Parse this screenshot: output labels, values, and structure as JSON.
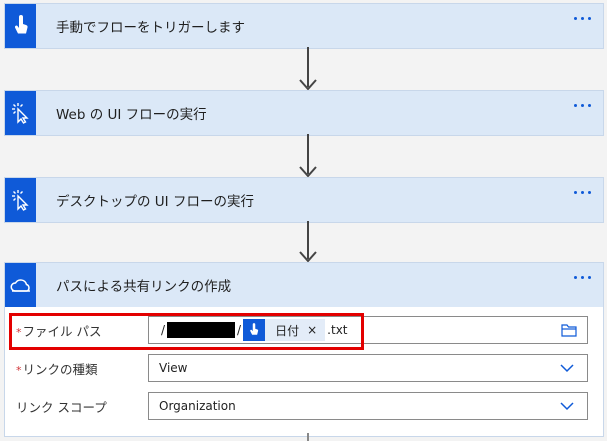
{
  "steps": [
    {
      "title": "手動でフローをトリガーします",
      "icon": "touch-icon"
    },
    {
      "title": "Web の UI フローの実行",
      "icon": "cursor-click-icon"
    },
    {
      "title": "デスクトップの UI フローの実行",
      "icon": "cursor-click-icon"
    },
    {
      "title": "パスによる共有リンクの作成",
      "icon": "onedrive-cloud-icon"
    }
  ],
  "form": {
    "file_path": {
      "label": "ファイル パス",
      "required": "*",
      "prefix": "/",
      "slash": "/",
      "token_label": "日付",
      "token_close": "×",
      "suffix": ".txt"
    },
    "link_type": {
      "label": "リンクの種類",
      "required": "*",
      "value": "View"
    },
    "link_scope": {
      "label": "リンク スコープ",
      "value": "Organization"
    }
  },
  "colors": {
    "accent": "#0f5ad8",
    "header_bg": "#dbe8f7",
    "highlight": "#e30000",
    "required": "#d13438"
  }
}
